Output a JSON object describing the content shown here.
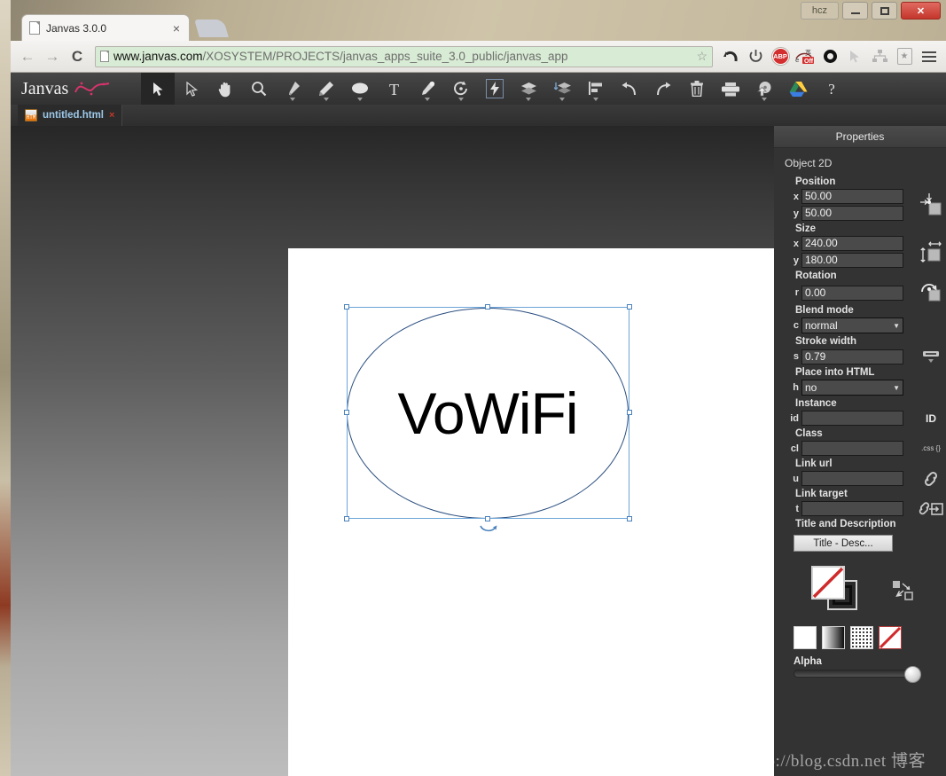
{
  "browser": {
    "tab": {
      "title": "Janvas 3.0.0",
      "close_label": "×",
      "icon": "page-icon"
    },
    "new_tab_label": "",
    "nav": {
      "back_label": "←",
      "forward_label": "→",
      "reload_label": "C",
      "url_domain": "www.janvas.com",
      "url_path": "/XOSYSTEM/PROJECTS/janvas_apps_suite_3.0_public/janvas_app",
      "star_label": "☆"
    },
    "extensions": [
      {
        "name": "undo-extension-icon",
        "glyph": "↶"
      },
      {
        "name": "power-extension-icon",
        "glyph": "⏻"
      },
      {
        "name": "adblock-plus-icon",
        "glyph": "ABP"
      },
      {
        "name": "translate-extension-icon",
        "glyph": "英"
      },
      {
        "name": "circle-extension-icon",
        "glyph": ""
      },
      {
        "name": "cursor-extension-icon",
        "glyph": "➤"
      },
      {
        "name": "sitemap-extension-icon",
        "glyph": "⚭"
      },
      {
        "name": "bookmark-extension-icon",
        "glyph": "★"
      },
      {
        "name": "chrome-menu-icon",
        "glyph": "☰"
      }
    ],
    "window_controls": {
      "profile_label": "hcz",
      "minimize_label": "",
      "maximize_label": "",
      "close_label": "✕"
    }
  },
  "app": {
    "brand": "Janvas",
    "toolbar_tools": [
      {
        "name": "selection-tool",
        "label": "Selection",
        "selected": true,
        "menu": false
      },
      {
        "name": "direct-selection-tool",
        "label": "Direct Selection",
        "selected": false,
        "menu": false
      },
      {
        "name": "hand-tool",
        "label": "Hand",
        "selected": false,
        "menu": false
      },
      {
        "name": "zoom-tool",
        "label": "Zoom",
        "selected": false,
        "menu": false
      },
      {
        "name": "pen-tool",
        "label": "Pen",
        "selected": false,
        "menu": true
      },
      {
        "name": "pencil-tool",
        "label": "Pencil",
        "selected": false,
        "menu": true
      },
      {
        "name": "ellipse-tool",
        "label": "Ellipse",
        "selected": false,
        "menu": true
      },
      {
        "name": "text-tool",
        "label": "Text",
        "selected": false,
        "menu": false
      },
      {
        "name": "eyedropper-tool",
        "label": "Eyedropper",
        "selected": false,
        "menu": true
      },
      {
        "name": "rotate-tool",
        "label": "Rotate",
        "selected": false,
        "menu": true
      },
      {
        "name": "effects-tool",
        "label": "Effects",
        "selected": false,
        "menu": false
      },
      {
        "name": "layers-tool",
        "label": "Layers",
        "selected": false,
        "menu": true
      },
      {
        "name": "arrange-tool",
        "label": "Arrange",
        "selected": false,
        "menu": true
      },
      {
        "name": "align-tool",
        "label": "Align",
        "selected": false,
        "menu": true
      },
      {
        "name": "undo-tool",
        "label": "Undo",
        "selected": false,
        "menu": false
      },
      {
        "name": "redo-tool",
        "label": "Redo",
        "selected": false,
        "menu": false
      },
      {
        "name": "delete-tool",
        "label": "Delete",
        "selected": false,
        "menu": false
      },
      {
        "name": "export-tool",
        "label": "Export",
        "selected": false,
        "menu": false
      },
      {
        "name": "save-to-disk-tool",
        "label": "Save to disk",
        "selected": false,
        "menu": true
      },
      {
        "name": "google-drive-tool",
        "label": "Google Drive",
        "selected": false,
        "menu": false
      },
      {
        "name": "help-tool",
        "label": "Help",
        "selected": false,
        "menu": false
      }
    ],
    "document_tab": {
      "name": "untitled.html",
      "close_label": "×",
      "icon": "html-file-icon"
    }
  },
  "canvas": {
    "shape_text": "VoWiFi",
    "shape_type": "ellipse",
    "selection_color": "#6ba4d8",
    "stroke_color": "#2b4f80",
    "page_background": "#ffffff"
  },
  "properties": {
    "header": "Properties",
    "object_title": "Object 2D",
    "groups": {
      "position": {
        "label": "Position",
        "x": {
          "key": "x",
          "value": "50.00"
        },
        "y": {
          "key": "y",
          "value": "50.00"
        },
        "icon": "position-icon"
      },
      "size": {
        "label": "Size",
        "x": {
          "key": "x",
          "value": "240.00"
        },
        "y": {
          "key": "y",
          "value": "180.00"
        },
        "icon": "size-icon"
      },
      "rotation": {
        "label": "Rotation",
        "r": {
          "key": "r",
          "value": "0.00"
        },
        "icon": "rotation-icon"
      },
      "blend_mode": {
        "label": "Blend mode",
        "key": "c",
        "value": "normal",
        "caret": "▼"
      },
      "stroke_width": {
        "label": "Stroke width",
        "key": "s",
        "value": "0.79",
        "icon": "stroke-width-icon"
      },
      "place_into_html": {
        "label": "Place into HTML",
        "key": "h",
        "value": "no",
        "caret": "▼"
      },
      "instance": {
        "label": "Instance",
        "key": "id",
        "value": "",
        "placeholder": "",
        "icon_text": "ID"
      },
      "class": {
        "label": "Class",
        "key": "cl",
        "value": "",
        "placeholder": "",
        "icon_text": ".css {}"
      },
      "link_url": {
        "label": "Link url",
        "key": "u",
        "value": "",
        "placeholder": "",
        "icon": "link-icon"
      },
      "link_target": {
        "label": "Link target",
        "key": "t",
        "value": "",
        "placeholder": "",
        "icon": "link-target-icon"
      },
      "title_description": {
        "label": "Title and Description",
        "button_label": "Title - Desc..."
      }
    },
    "swatches": {
      "fill_name": "fill-swatch-none",
      "stroke_name": "stroke-swatch-black",
      "swap_name": "swap-fill-stroke-icon"
    },
    "fill_types": [
      {
        "name": "fill-type-solid",
        "label": "Solid"
      },
      {
        "name": "fill-type-gradient",
        "label": "Gradient"
      },
      {
        "name": "fill-type-pattern",
        "label": "Pattern"
      },
      {
        "name": "fill-type-none",
        "label": "None"
      }
    ],
    "alpha": {
      "label": "Alpha",
      "value": "100"
    }
  },
  "watermark": {
    "text": "http://blog.csdn.net ",
    "cn": "博客"
  }
}
